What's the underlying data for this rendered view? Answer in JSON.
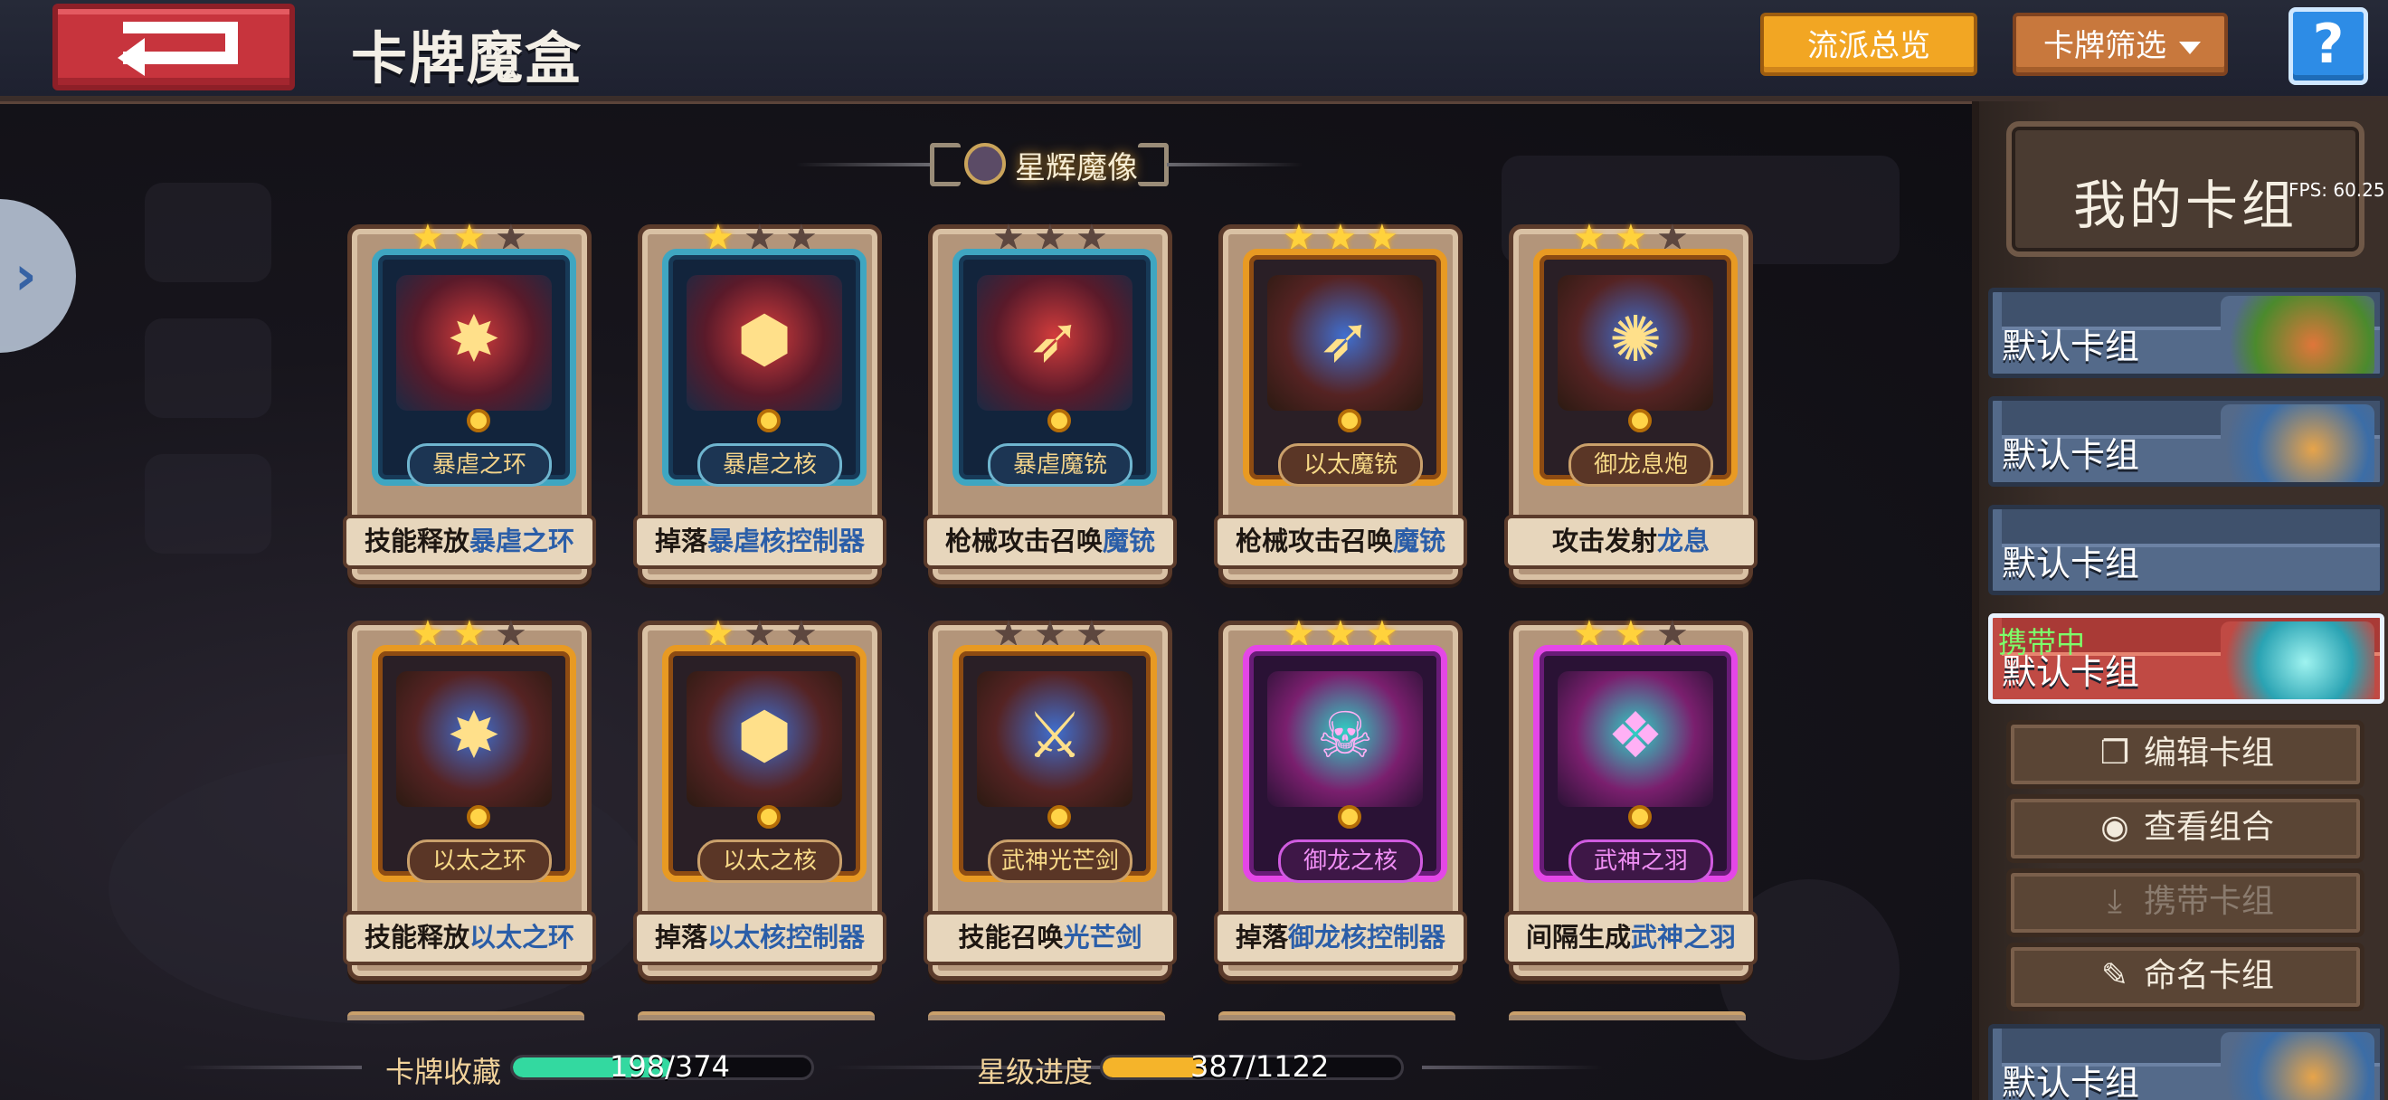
{
  "header": {
    "title": "卡牌魔盒",
    "overview_label": "流派总览",
    "filter_label": "卡牌筛选",
    "help_label": "?"
  },
  "category": {
    "title": "星辉魔像"
  },
  "cards": [
    {
      "name": "暴虐之环",
      "desc_pre": "技能释放",
      "desc_hl": "暴虐之环",
      "desc_post": "",
      "stars": 2,
      "max_stars": 3,
      "rarity": "blue",
      "icon": "ring-icon"
    },
    {
      "name": "暴虐之核",
      "desc_pre": "掉落",
      "desc_hl": "暴虐核控制器",
      "desc_post": "",
      "stars": 1,
      "max_stars": 3,
      "rarity": "blue",
      "icon": "core-icon"
    },
    {
      "name": "暴虐魔铳",
      "desc_pre": "枪械攻击召唤",
      "desc_hl": "魔铳",
      "desc_post": "",
      "stars": 0,
      "max_stars": 3,
      "rarity": "blue",
      "icon": "gun-icon"
    },
    {
      "name": "以太魔铳",
      "desc_pre": "枪械攻击召唤",
      "desc_hl": "魔铳",
      "desc_post": "",
      "stars": 3,
      "max_stars": 3,
      "rarity": "gold",
      "icon": "gun-icon"
    },
    {
      "name": "御龙息炮",
      "desc_pre": "攻击发射",
      "desc_hl": "龙息",
      "desc_post": "",
      "stars": 2,
      "max_stars": 3,
      "rarity": "gold",
      "icon": "cannon-icon"
    },
    {
      "name": "以太之环",
      "desc_pre": "技能释放",
      "desc_hl": "以太之环",
      "desc_post": "",
      "stars": 2,
      "max_stars": 3,
      "rarity": "gold",
      "icon": "ring-icon"
    },
    {
      "name": "以太之核",
      "desc_pre": "掉落",
      "desc_hl": "以太核控制器",
      "desc_post": "",
      "stars": 1,
      "max_stars": 3,
      "rarity": "gold",
      "icon": "core-icon"
    },
    {
      "name": "武神光芒剑",
      "desc_pre": "技能召唤",
      "desc_hl": "光芒剑",
      "desc_post": "",
      "stars": 0,
      "max_stars": 3,
      "rarity": "gold",
      "icon": "sword-icon"
    },
    {
      "name": "御龙之核",
      "desc_pre": "掉落",
      "desc_hl": "御龙核控制器",
      "desc_post": "",
      "stars": 3,
      "max_stars": 3,
      "rarity": "purple",
      "icon": "dragon-core-icon"
    },
    {
      "name": "武神之羽",
      "desc_pre": "间隔生成",
      "desc_hl": "武神之羽",
      "desc_post": "",
      "stars": 2,
      "max_stars": 3,
      "rarity": "purple",
      "icon": "feather-icon"
    }
  ],
  "progress": {
    "collection_label": "卡牌收藏",
    "collection_value": "198/374",
    "collection_current": 198,
    "collection_total": 374,
    "star_label": "星级进度",
    "star_value": "387/1122",
    "star_current": 387,
    "star_total": 1122
  },
  "sidebar": {
    "title": "我的卡组",
    "fps": "FPS: 60.25",
    "decks": [
      {
        "name": "默认卡组",
        "active": false
      },
      {
        "name": "默认卡组",
        "active": false
      },
      {
        "name": "默认卡组",
        "active": false
      },
      {
        "name": "默认卡组",
        "active": true,
        "tag": "携带中"
      },
      {
        "name": "默认卡组",
        "active": false
      }
    ],
    "buttons": {
      "edit": "编辑卡组",
      "view": "查看组合",
      "carry": "携带卡组",
      "rename": "命名卡组"
    }
  },
  "colors": {
    "accent_orange": "#f2a623",
    "filter_brown": "#c8783d",
    "help_blue": "#2d8ce6",
    "collection_bar": "#33d9a0",
    "star_bar": "#f5b42a",
    "back_red": "#c7343d"
  }
}
